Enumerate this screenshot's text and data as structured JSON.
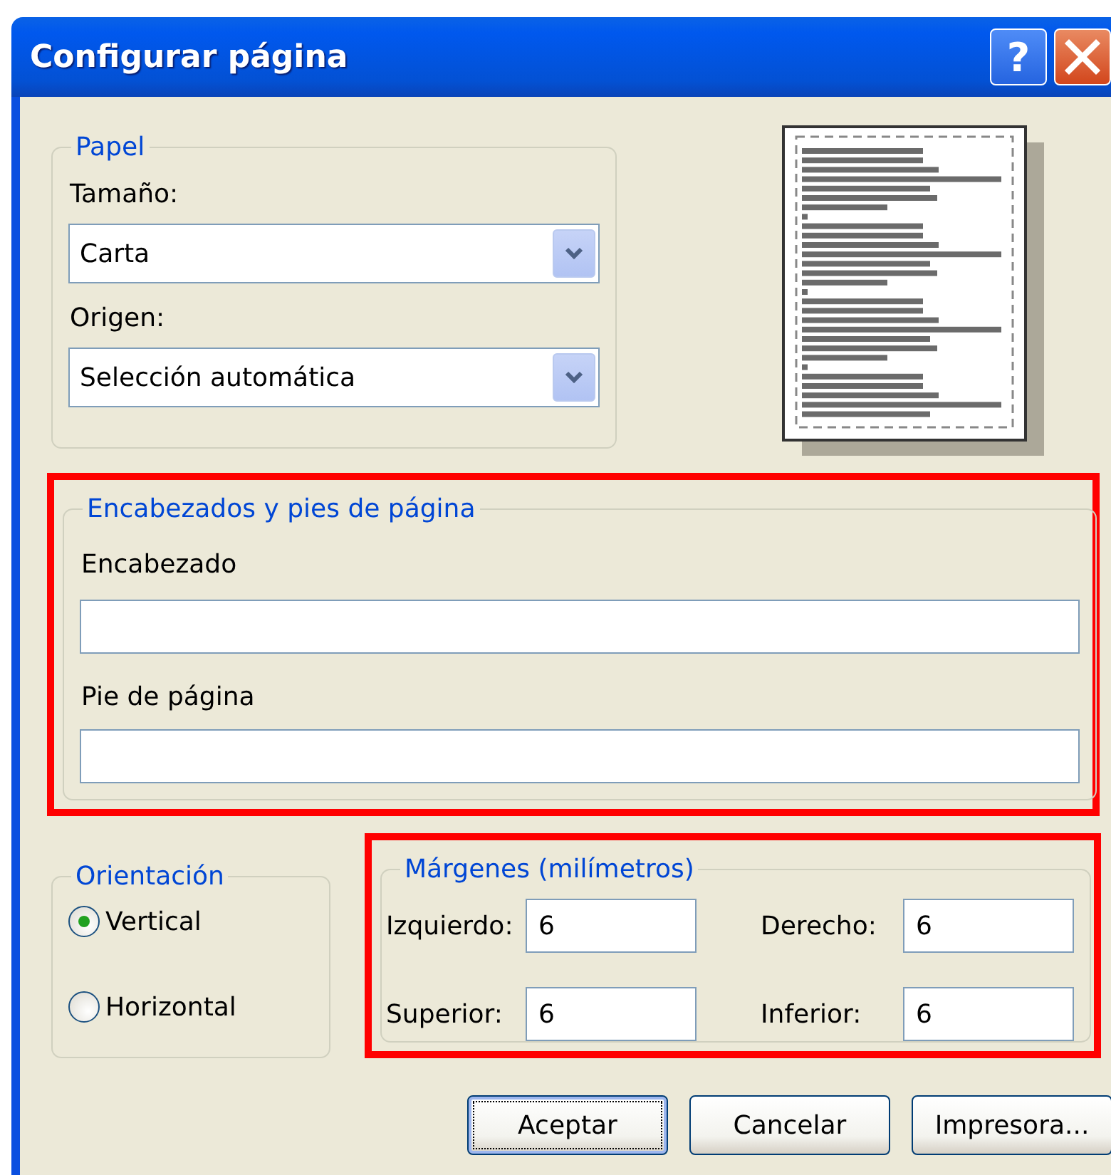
{
  "window": {
    "title": "Configurar página",
    "help_button": {
      "label": "?"
    }
  },
  "paper": {
    "legend": "Papel",
    "fields": [
      {
        "label": "Tamaño:",
        "value": "Carta"
      },
      {
        "label": "Origen:",
        "value": "Selección automática"
      }
    ]
  },
  "headers_footers": {
    "legend": "Encabezados y pies de página",
    "highlighted": true,
    "fields": [
      {
        "label": "Encabezado"
      },
      {
        "label": "Pie de página"
      }
    ]
  },
  "orientation": {
    "legend": "Orientación",
    "options": [
      {
        "label": "Vertical",
        "selected": true
      },
      {
        "label": "Horizontal",
        "selected": false
      }
    ]
  },
  "margins": {
    "legend": "Márgenes (milímetros)",
    "highlighted": true,
    "fields": [
      {
        "label": "Izquierdo:",
        "value": "6"
      },
      {
        "label": "Derecho:",
        "value": "6"
      },
      {
        "label": "Superior:",
        "value": "6"
      },
      {
        "label": "Inferior:",
        "value": "6"
      }
    ]
  },
  "buttons": [
    {
      "label": "Aceptar",
      "default": true
    },
    {
      "label": "Cancelar",
      "default": false
    },
    {
      "label": "Impresora...",
      "default": false
    }
  ]
}
